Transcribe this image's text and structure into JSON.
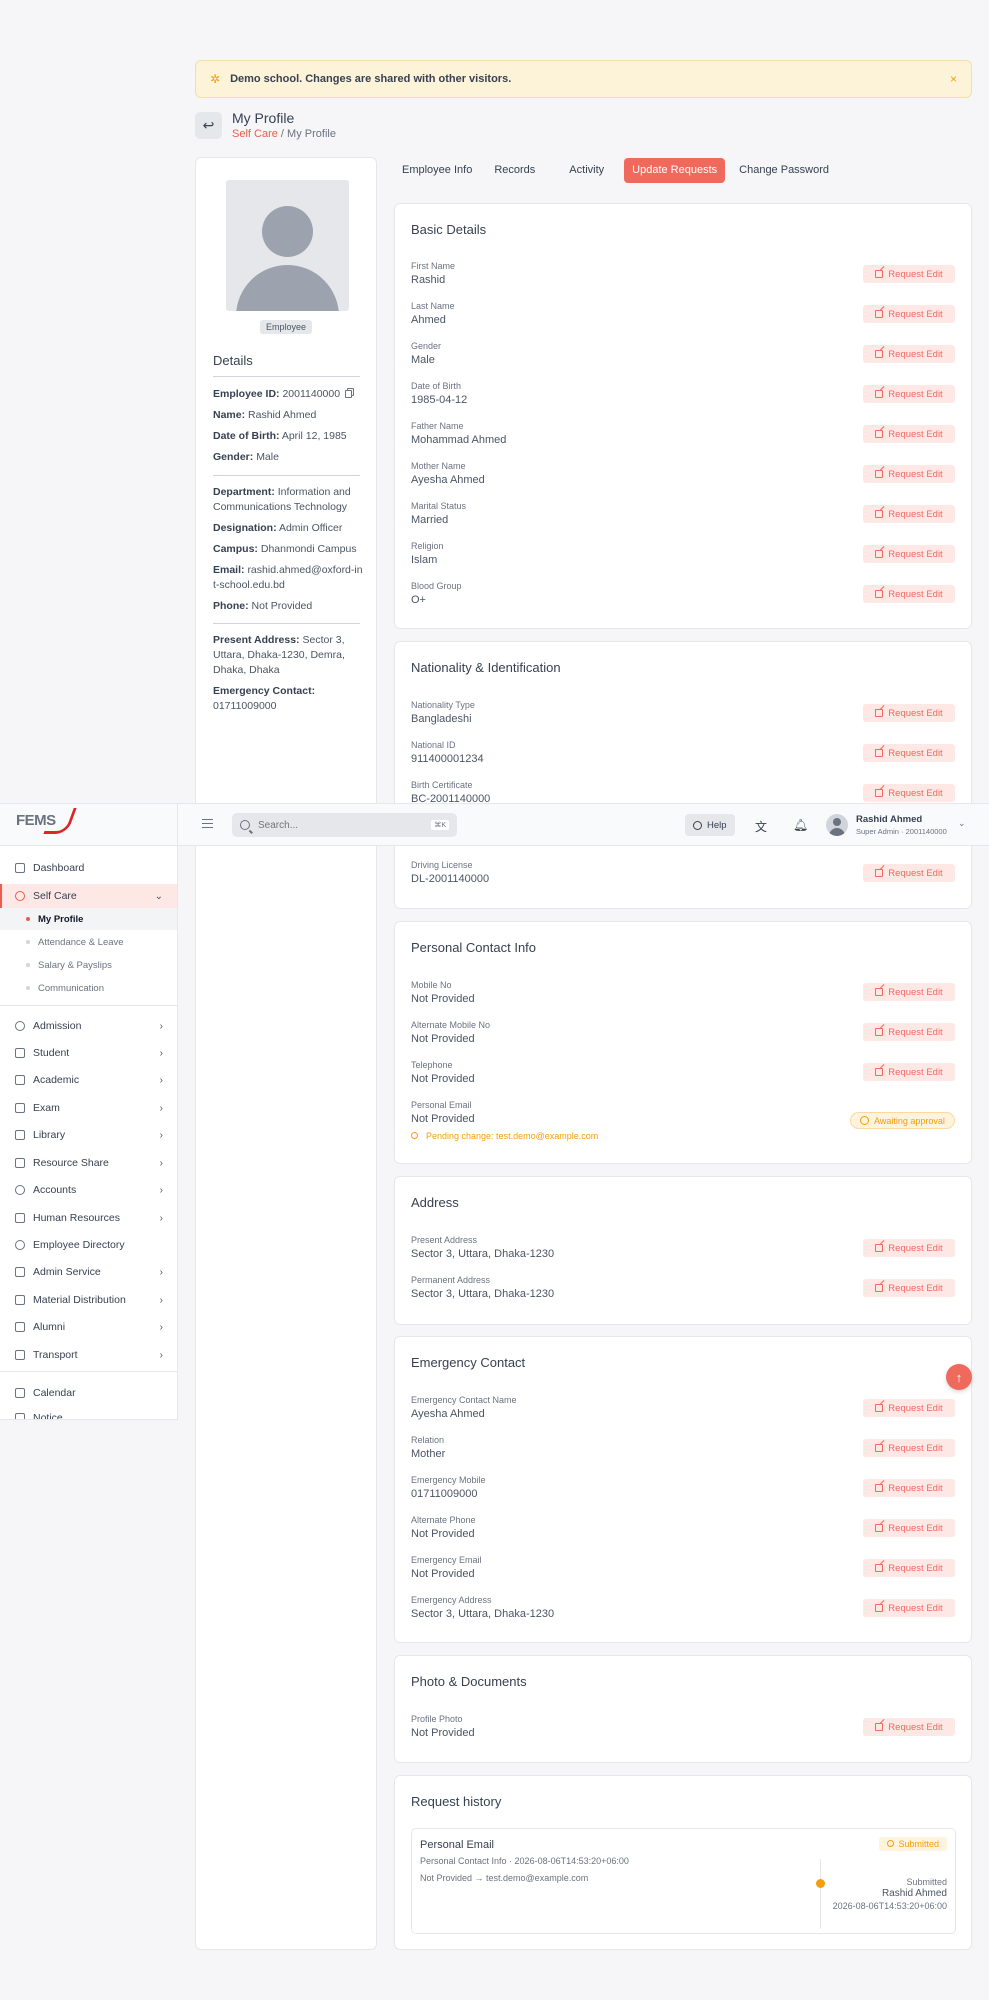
{
  "banner": {
    "text": "Demo school. Changes are shared with other visitors.",
    "close": "×"
  },
  "header": {
    "title": "My Profile",
    "crumb_parent": "Self Care",
    "crumb_sep": "/",
    "crumb_current": "My Profile"
  },
  "profile": {
    "role": "Employee",
    "details_title": "Details",
    "employee_id_label": "Employee ID:",
    "employee_id": "2001140000",
    "name_label": "Name:",
    "name": "Rashid Ahmed",
    "dob_label": "Date of Birth:",
    "dob": "April 12, 1985",
    "gender_label": "Gender:",
    "gender": "Male",
    "department_label": "Department:",
    "department": "Information and Communications Technology",
    "designation_label": "Designation:",
    "designation": "Admin Officer",
    "campus_label": "Campus:",
    "campus": "Dhanmondi Campus",
    "email_label": "Email:",
    "email": "rashid.ahmed@oxford-int-school.edu.bd",
    "phone_label": "Phone:",
    "phone": "Not Provided",
    "present_address_label": "Present Address:",
    "present_address": "Sector 3, Uttara, Dhaka-1230, Demra, Dhaka, Dhaka",
    "emergency_label": "Emergency Contact:",
    "emergency": "01711009000"
  },
  "tabs": [
    "Employee Info",
    "Records",
    "Activity",
    "Update Requests",
    "Change Password"
  ],
  "request_edit": "Request Edit",
  "sections": {
    "basic": {
      "title": "Basic Details",
      "fields": [
        {
          "label": "First Name",
          "value": "Rashid"
        },
        {
          "label": "Last Name",
          "value": "Ahmed"
        },
        {
          "label": "Gender",
          "value": "Male"
        },
        {
          "label": "Date of Birth",
          "value": "1985-04-12"
        },
        {
          "label": "Father Name",
          "value": "Mohammad Ahmed"
        },
        {
          "label": "Mother Name",
          "value": "Ayesha Ahmed"
        },
        {
          "label": "Marital Status",
          "value": "Married"
        },
        {
          "label": "Religion",
          "value": "Islam"
        },
        {
          "label": "Blood Group",
          "value": "O+"
        }
      ]
    },
    "nationality": {
      "title": "Nationality & Identification",
      "fields": [
        {
          "label": "Nationality Type",
          "value": "Bangladeshi"
        },
        {
          "label": "National ID",
          "value": "911400001234"
        },
        {
          "label": "Birth Certificate",
          "value": "BC-2001140000"
        },
        {
          "label": "Driving License",
          "value": "DL-2001140000"
        }
      ]
    },
    "contact": {
      "title": "Personal Contact Info",
      "fields": [
        {
          "label": "Mobile No",
          "value": "Not Provided"
        },
        {
          "label": "Alternate Mobile No",
          "value": "Not Provided"
        },
        {
          "label": "Telephone",
          "value": "Not Provided"
        },
        {
          "label": "Personal Email",
          "value": "Not Provided"
        }
      ],
      "awaiting": "Awaiting approval",
      "pending": "Pending change: test.demo@example.com"
    },
    "address": {
      "title": "Address",
      "fields": [
        {
          "label": "Present Address",
          "value": "Sector 3, Uttara, Dhaka-1230"
        },
        {
          "label": "Permanent Address",
          "value": "Sector 3, Uttara, Dhaka-1230"
        }
      ]
    },
    "emergency": {
      "title": "Emergency Contact",
      "fields": [
        {
          "label": "Emergency Contact Name",
          "value": "Ayesha Ahmed"
        },
        {
          "label": "Relation",
          "value": "Mother"
        },
        {
          "label": "Emergency Mobile",
          "value": "01711009000"
        },
        {
          "label": "Alternate Phone",
          "value": "Not Provided"
        },
        {
          "label": "Emergency Email",
          "value": "Not Provided"
        },
        {
          "label": "Emergency Address",
          "value": "Sector 3, Uttara, Dhaka-1230"
        }
      ]
    },
    "photos": {
      "title": "Photo & Documents",
      "fields": [
        {
          "label": "Profile Photo",
          "value": "Not Provided"
        }
      ]
    },
    "history": {
      "title": "Request history",
      "item_title": "Personal Email",
      "item_sub": "Personal Contact Info · 2026-08-06T14:53:20+06:00",
      "item_change": "Not Provided → test.demo@example.com",
      "badge": "Submitted",
      "status": "Submitted",
      "by": "Rashid Ahmed",
      "time": "2026-08-06T14:53:20+06:00"
    }
  },
  "topbar": {
    "logo": "FEMS",
    "search_placeholder": "Search...",
    "search_kbd": "⌘K",
    "help": "Help",
    "user_name": "Rashid Ahmed",
    "user_role": "Super Admin · 2001140000"
  },
  "sidebar": {
    "items": [
      {
        "label": "Dashboard"
      },
      {
        "label": "Self Care"
      },
      {
        "label": "Admission"
      },
      {
        "label": "Student"
      },
      {
        "label": "Academic"
      },
      {
        "label": "Exam"
      },
      {
        "label": "Library"
      },
      {
        "label": "Resource Share"
      },
      {
        "label": "Accounts"
      },
      {
        "label": "Human Resources"
      },
      {
        "label": "Employee Directory"
      },
      {
        "label": "Admin Service"
      },
      {
        "label": "Material Distribution"
      },
      {
        "label": "Alumni"
      },
      {
        "label": "Transport"
      },
      {
        "label": "Calendar"
      },
      {
        "label": "Notice"
      }
    ],
    "sub_items": [
      {
        "label": "My Profile"
      },
      {
        "label": "Attendance & Leave"
      },
      {
        "label": "Salary & Payslips"
      },
      {
        "label": "Communication"
      }
    ]
  },
  "fab": "↑"
}
